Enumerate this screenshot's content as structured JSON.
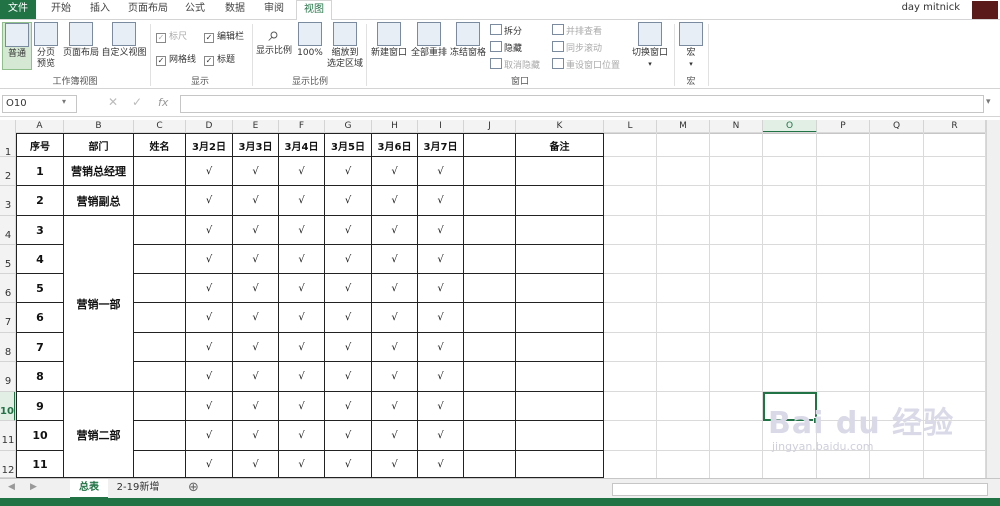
{
  "tabs": [
    "文件",
    "开始",
    "插入",
    "页面布局",
    "公式",
    "数据",
    "审阅",
    "视图"
  ],
  "active_tab": "视图",
  "user": "day mitnick",
  "ribbon": {
    "workbook_views": {
      "group": "工作簿视图",
      "normal": "普通",
      "pagebreak1": "分页",
      "pagebreak2": "预览",
      "page_layout": "页面布局",
      "custom": "自定义视图"
    },
    "show": {
      "group": "显示",
      "ruler": "标尺",
      "formula_bar": "编辑栏",
      "gridlines": "网格线",
      "headings": "标题"
    },
    "zoom": {
      "group": "显示比例",
      "zoom": "显示比例",
      "hundred": "100%",
      "zoom_sel1": "缩放到",
      "zoom_sel2": "选定区域"
    },
    "window": {
      "group": "窗口",
      "new_window": "新建窗口",
      "arrange_all": "全部重排",
      "freeze": "冻结窗格",
      "split": "拆分",
      "hide": "隐藏",
      "unhide": "取消隐藏",
      "side_by_side": "并排查看",
      "sync_scroll": "同步滚动",
      "reset_pos": "重设窗口位置",
      "switch": "切换窗口"
    },
    "macros": {
      "group": "宏",
      "macros": "宏"
    }
  },
  "namebox": "O10",
  "fx": "fx",
  "columns": [
    "A",
    "B",
    "C",
    "D",
    "E",
    "F",
    "G",
    "H",
    "I",
    "J",
    "K",
    "L",
    "M",
    "N",
    "O",
    "P",
    "Q",
    "R"
  ],
  "active_column": "O",
  "rows": [
    "1",
    "2",
    "3",
    "4",
    "5",
    "6",
    "7",
    "8",
    "9",
    "10",
    "11",
    "12"
  ],
  "active_row": "10",
  "table": {
    "headers": [
      "序号",
      "部门",
      "姓名",
      "3月2日",
      "3月3日",
      "3月4日",
      "3月5日",
      "3月6日",
      "3月7日",
      "",
      "备注"
    ],
    "seq": [
      "1",
      "2",
      "3",
      "4",
      "5",
      "6",
      "7",
      "8",
      "9",
      "10",
      "11"
    ],
    "dept_rows": {
      "r1": "营销总经理",
      "r2": "营销副总",
      "g1": "营销一部",
      "g2": "营销二部"
    },
    "check": "√"
  },
  "sheets": [
    "总表",
    "2-19新增"
  ],
  "active_sheet": "总表",
  "watermark": {
    "main": "Bai du 经验",
    "sub": "jingyan.baidu.com"
  }
}
